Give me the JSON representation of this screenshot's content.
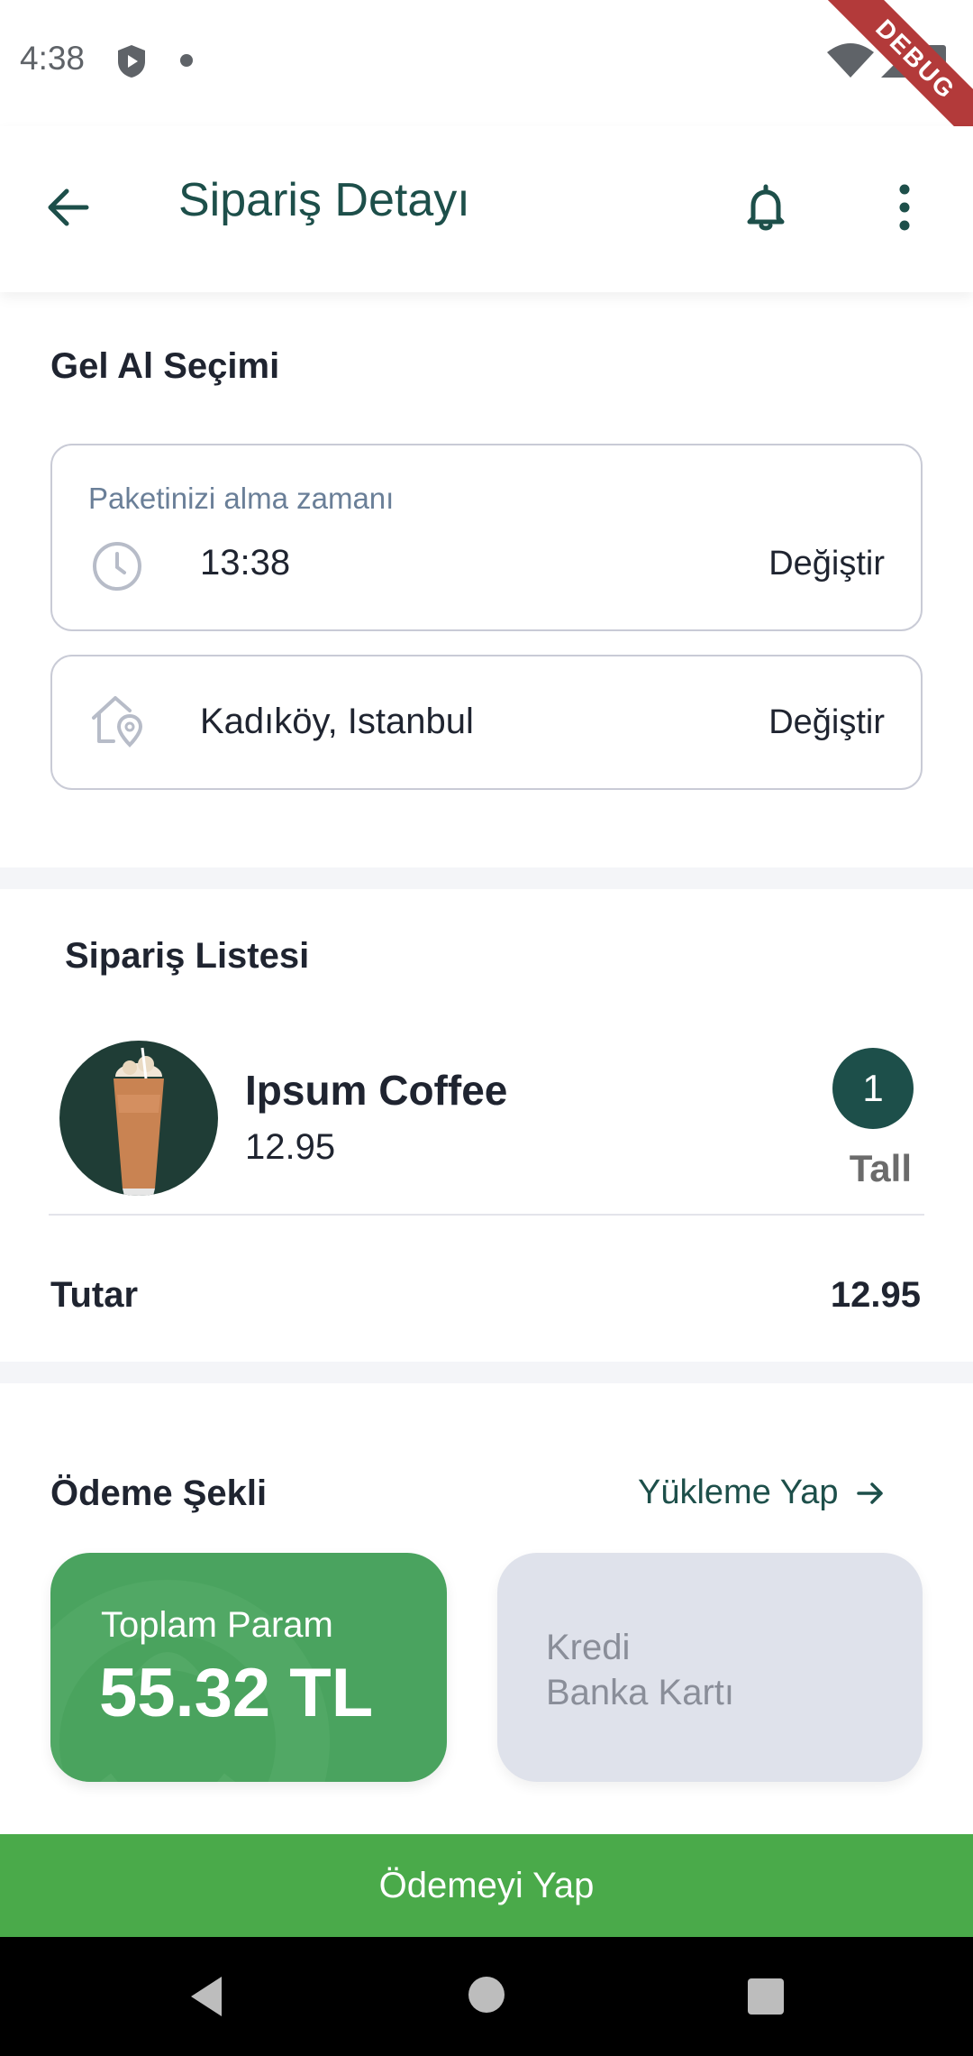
{
  "status_bar": {
    "time": "4:38",
    "debug_label": "DEBUG"
  },
  "app_bar": {
    "title": "Sipariş Detayı"
  },
  "pickup": {
    "section_title": "Gel Al Seçimi",
    "time_card": {
      "label": "Paketinizi alma zamanı",
      "value": "13:38",
      "action": "Değiştir",
      "icon": "clock-icon"
    },
    "location_card": {
      "value": "Kadıköy, Istanbul",
      "action": "Değiştir",
      "icon": "home-location-icon"
    }
  },
  "order": {
    "section_title": "Sipariş Listesi",
    "items": [
      {
        "name": "Ipsum Coffee",
        "price": "12.95",
        "quantity": "1",
        "size": "Tall"
      }
    ],
    "total_label": "Tutar",
    "total_value": "12.95"
  },
  "payment": {
    "section_title": "Ödeme Şekli",
    "topup_label": "Yükleme Yap",
    "wallet": {
      "label": "Toplam Param",
      "amount": "55.32 TL"
    },
    "credit": {
      "line1": "Kredi",
      "line2": "Banka Kartı"
    }
  },
  "pay_button": {
    "label": "Ödemeyi Yap"
  },
  "colors": {
    "primary": "#1d4f4a",
    "wallet_green": "#4aa35f",
    "pay_green": "#4aaa4a",
    "card_grey": "#dfe2eb"
  }
}
